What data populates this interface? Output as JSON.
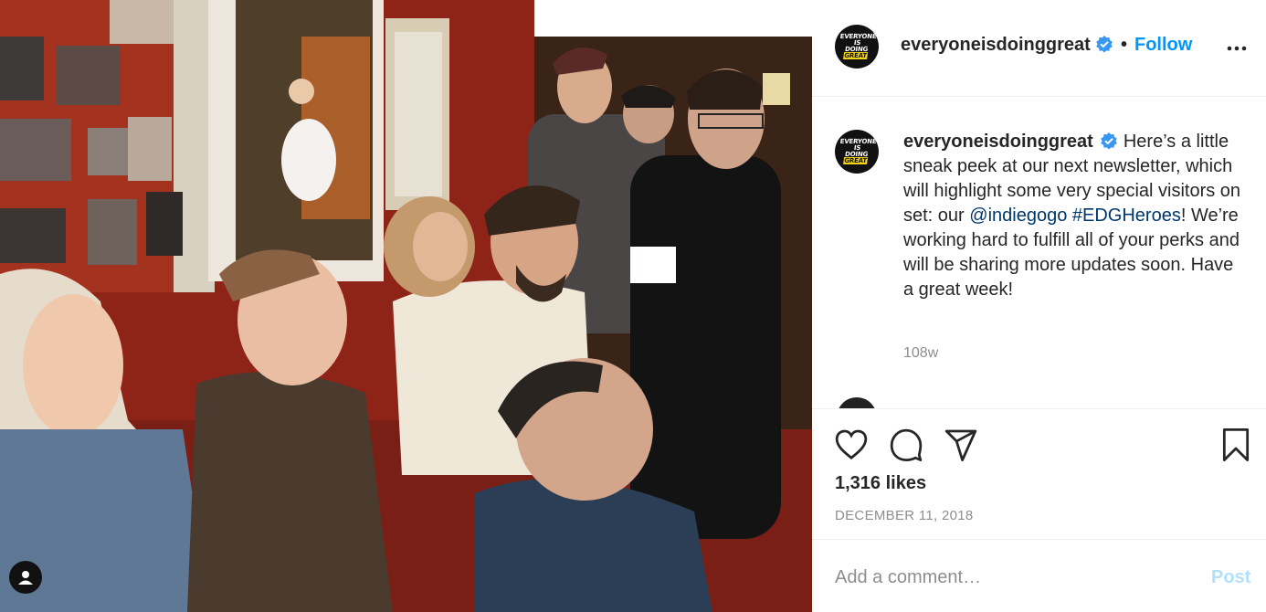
{
  "post": {
    "username": "everyoneisdoinggreat",
    "follow_label": "Follow",
    "dot": "•",
    "avatar_logo": {
      "line1": "EVERYONE IS",
      "line2": "DOING",
      "line2_highlight": "GREAT"
    },
    "caption": {
      "text_1": "Here’s a little sneak peek at our next newsletter, which will highlight some very special visitors on set: our ",
      "mention": "@indiegogo",
      "text_2": " ",
      "hashtag": "#EDGHeroes",
      "text_3": "! We’re working hard to fulfill all of your perks and will be sharing more updates soon. Have a great week!"
    },
    "time_ago": "108w",
    "likes": "1,316 likes",
    "date": "DECEMBER 11, 2018"
  },
  "comment": {
    "placeholder": "Add a comment…",
    "post_label": "Post"
  },
  "colors": {
    "accent": "#0095f6",
    "verified": "#3897f0",
    "post_disabled": "#b2dffc",
    "logo_yellow": "#f5d415"
  },
  "icons": [
    "verified-badge-icon",
    "more-options-icon",
    "heart-icon",
    "comment-icon",
    "share-icon",
    "bookmark-icon",
    "user-tag-icon"
  ]
}
